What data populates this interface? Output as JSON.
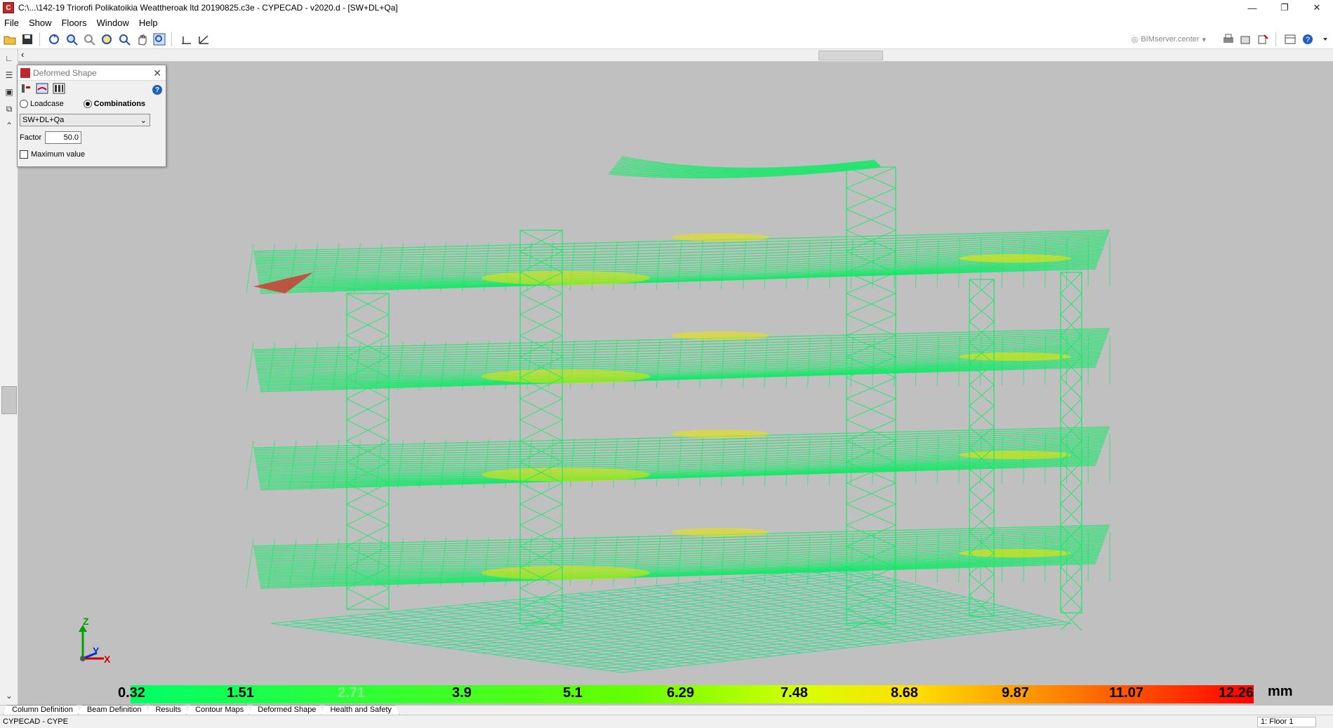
{
  "title": "C:\\...\\142-19 Triorofi Polikatoikia Weattheroak ltd 20190825.c3e - CYPECAD - v2020.d - [SW+DL+Qa]",
  "menu": [
    "File",
    "Show",
    "Floors",
    "Window",
    "Help"
  ],
  "toolbar": {
    "bimserver_label": "BIMserver.center"
  },
  "panel": {
    "title": "Deformed Shape",
    "radio_loadcase": "Loadcase",
    "radio_combinations": "Combinations",
    "combination_value": "SW+DL+Qa",
    "factor_label": "Factor",
    "factor_value": "50.0",
    "max_value_label": "Maximum value"
  },
  "axes": {
    "z": "Z",
    "y": "Y",
    "x": "X"
  },
  "legend": {
    "values": [
      "0.32",
      "1.51",
      "2.71",
      "3.9",
      "5.1",
      "6.29",
      "7.48",
      "8.68",
      "9.87",
      "11.07",
      "12.26"
    ],
    "unit": "mm",
    "colors": [
      "#00ff66",
      "#33ff33",
      "#66ff00",
      "#99ff00",
      "#ccff00",
      "#ffff00",
      "#ffcc00",
      "#ff9900",
      "#ff6600",
      "#ff3300",
      "#ff0000"
    ]
  },
  "tabs": [
    "Column Definition",
    "Beam Definition",
    "Results",
    "Contour Maps",
    "Deformed Shape",
    "Health and Safety"
  ],
  "status": {
    "left": "CYPECAD - CYPE",
    "right": "1: Floor 1"
  },
  "colors": {
    "viewport_bg": "#c0c0c0",
    "mesh_green": "#19e86a",
    "mesh_yellow": "#e8e600",
    "mesh_red": "#e0201e"
  }
}
